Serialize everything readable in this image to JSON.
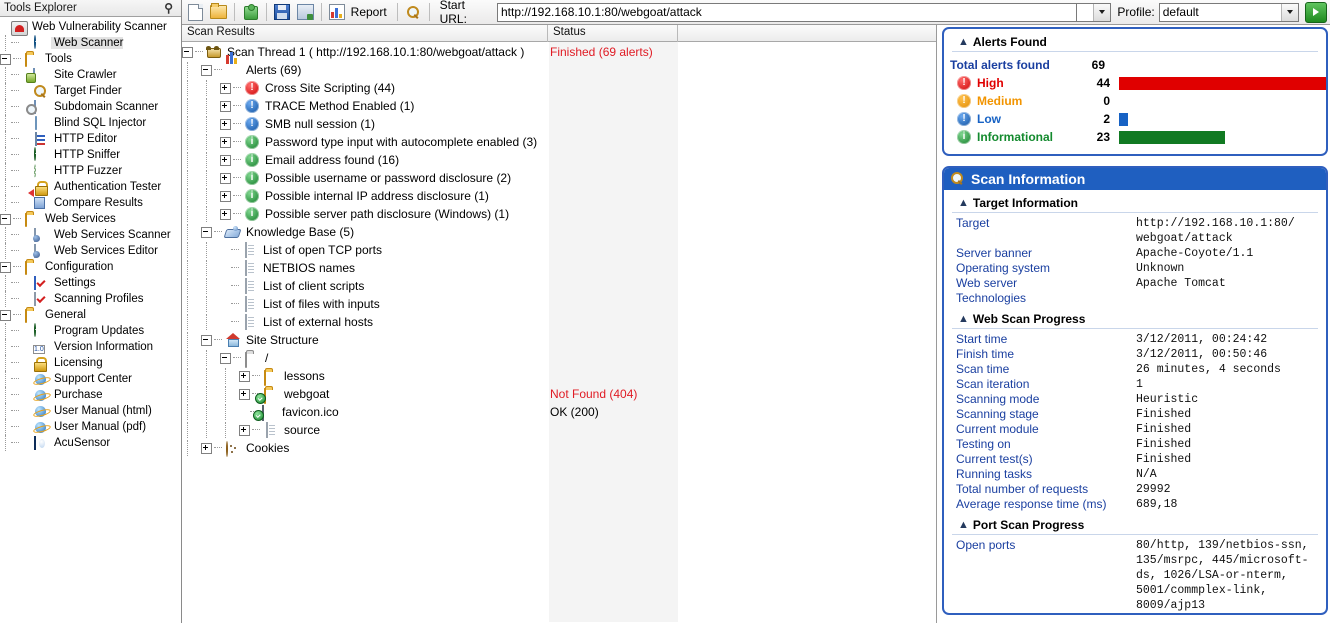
{
  "sidebar": {
    "title": "Tools Explorer",
    "pin_icon": "pin-icon",
    "items": [
      {
        "label": "Web Vulnerability Scanner",
        "icon": "app-logo-icon",
        "level": 0,
        "exp": "none"
      },
      {
        "label": "Web Scanner",
        "icon": "web-scanner-icon",
        "level": 1,
        "exp": "none",
        "selected": true
      },
      {
        "label": "Tools",
        "icon": "folder-icon",
        "level": 0,
        "exp": "minus"
      },
      {
        "label": "Site Crawler",
        "icon": "site-crawler-icon",
        "level": 1,
        "exp": "none"
      },
      {
        "label": "Target Finder",
        "icon": "target-finder-icon",
        "level": 1,
        "exp": "none"
      },
      {
        "label": "Subdomain Scanner",
        "icon": "subdomain-scanner-icon",
        "level": 1,
        "exp": "none"
      },
      {
        "label": "Blind SQL Injector",
        "icon": "blind-sql-injector-icon",
        "level": 1,
        "exp": "none"
      },
      {
        "label": "HTTP Editor",
        "icon": "http-editor-icon",
        "level": 1,
        "exp": "none"
      },
      {
        "label": "HTTP Sniffer",
        "icon": "http-sniffer-icon",
        "level": 1,
        "exp": "none"
      },
      {
        "label": "HTTP Fuzzer",
        "icon": "http-fuzzer-icon",
        "level": 1,
        "exp": "none"
      },
      {
        "label": "Authentication Tester",
        "icon": "authentication-tester-icon",
        "level": 1,
        "exp": "none"
      },
      {
        "label": "Compare Results",
        "icon": "compare-results-icon",
        "level": 1,
        "exp": "none"
      },
      {
        "label": "Web Services",
        "icon": "folder-icon",
        "level": 0,
        "exp": "minus"
      },
      {
        "label": "Web Services Scanner",
        "icon": "web-services-scanner-icon",
        "level": 1,
        "exp": "none"
      },
      {
        "label": "Web Services Editor",
        "icon": "web-services-editor-icon",
        "level": 1,
        "exp": "none"
      },
      {
        "label": "Configuration",
        "icon": "folder-icon",
        "level": 0,
        "exp": "minus"
      },
      {
        "label": "Settings",
        "icon": "settings-icon",
        "level": 1,
        "exp": "none"
      },
      {
        "label": "Scanning Profiles",
        "icon": "scanning-profiles-icon",
        "level": 1,
        "exp": "none"
      },
      {
        "label": "General",
        "icon": "folder-icon",
        "level": 0,
        "exp": "minus"
      },
      {
        "label": "Program Updates",
        "icon": "program-updates-icon",
        "level": 1,
        "exp": "none"
      },
      {
        "label": "Version Information",
        "icon": "version-information-icon",
        "level": 1,
        "exp": "none"
      },
      {
        "label": "Licensing",
        "icon": "licensing-icon",
        "level": 1,
        "exp": "none"
      },
      {
        "label": "Support Center",
        "icon": "support-center-icon",
        "level": 1,
        "exp": "none"
      },
      {
        "label": "Purchase",
        "icon": "purchase-icon",
        "level": 1,
        "exp": "none"
      },
      {
        "label": "User Manual (html)",
        "icon": "user-manual-html-icon",
        "level": 1,
        "exp": "none"
      },
      {
        "label": "User Manual (pdf)",
        "icon": "user-manual-pdf-icon",
        "level": 1,
        "exp": "none"
      },
      {
        "label": "AcuSensor",
        "icon": "acusensor-icon",
        "level": 1,
        "exp": "none"
      }
    ]
  },
  "toolbar": {
    "new_label": "new-scan-icon",
    "open_label": "open-icon",
    "addon_label": "addon-icon",
    "save_label": "save-icon",
    "saveas_label": "save-as-icon",
    "report_label": "Report",
    "search_label": "search-icon",
    "start_url_label": "Start URL:",
    "start_url_value": "http://192.168.10.1:80/webgoat/attack",
    "profile_label": "Profile:",
    "profile_value": "default",
    "go_label": "go-button"
  },
  "results": {
    "col_scan_results": "Scan Results",
    "col_status": "Status",
    "tree": [
      {
        "label": "Scan Thread 1 ( http://192.168.10.1:80/webgoat/attack )",
        "icon": "scan-thread-icon",
        "level": 0,
        "exp": "minus",
        "status": "Finished (69 alerts)",
        "status_color": "red"
      },
      {
        "label": "Alerts (69)",
        "icon": "alerts-chart-icon",
        "level": 1,
        "exp": "minus"
      },
      {
        "label": "Cross Site Scripting (44)",
        "icon": "severity-high-icon",
        "level": 2,
        "exp": "plus"
      },
      {
        "label": "TRACE Method Enabled (1)",
        "icon": "severity-low-icon",
        "level": 2,
        "exp": "plus"
      },
      {
        "label": "SMB null session (1)",
        "icon": "severity-low-icon",
        "level": 2,
        "exp": "plus"
      },
      {
        "label": "Password type input with autocomplete enabled (3)",
        "icon": "severity-info-icon",
        "level": 2,
        "exp": "plus"
      },
      {
        "label": "Email address found (16)",
        "icon": "severity-info-icon",
        "level": 2,
        "exp": "plus"
      },
      {
        "label": "Possible username or password disclosure (2)",
        "icon": "severity-info-icon",
        "level": 2,
        "exp": "plus"
      },
      {
        "label": "Possible internal IP address disclosure (1)",
        "icon": "severity-info-icon",
        "level": 2,
        "exp": "plus"
      },
      {
        "label": "Possible server path disclosure (Windows) (1)",
        "icon": "severity-info-icon",
        "level": 2,
        "exp": "plus"
      },
      {
        "label": "Knowledge Base (5)",
        "icon": "knowledge-base-icon",
        "level": 1,
        "exp": "minus"
      },
      {
        "label": "List of open TCP ports",
        "icon": "document-icon",
        "level": 2,
        "exp": "none"
      },
      {
        "label": "NETBIOS names",
        "icon": "document-icon",
        "level": 2,
        "exp": "none"
      },
      {
        "label": "List of client scripts",
        "icon": "document-icon",
        "level": 2,
        "exp": "none"
      },
      {
        "label": "List of files with inputs",
        "icon": "document-icon",
        "level": 2,
        "exp": "none"
      },
      {
        "label": "List of external hosts",
        "icon": "document-icon",
        "level": 2,
        "exp": "none"
      },
      {
        "label": "Site Structure",
        "icon": "site-structure-icon",
        "level": 1,
        "exp": "minus"
      },
      {
        "label": "/",
        "icon": "folder-open-icon",
        "level": 2,
        "exp": "minus"
      },
      {
        "label": "lessons",
        "icon": "folder-icon",
        "level": 3,
        "exp": "plus"
      },
      {
        "label": "webgoat",
        "icon": "folder-ok-icon",
        "level": 3,
        "exp": "plus",
        "status": "Not Found (404)",
        "status_color": "red"
      },
      {
        "label": "favicon.ico",
        "icon": "file-ok-icon",
        "level": 3,
        "exp": "none",
        "status": "OK (200)",
        "status_color": "blk"
      },
      {
        "label": "source",
        "icon": "document-icon",
        "level": 3,
        "exp": "plus"
      },
      {
        "label": "Cookies",
        "icon": "cookies-icon",
        "level": 1,
        "exp": "plus"
      }
    ]
  },
  "alerts_panel": {
    "title": "Alerts Found",
    "total_label": "Total alerts found",
    "total_value": "69",
    "rows": [
      {
        "name": "High",
        "value": "44",
        "bar_pct": 100,
        "color": "#e00000",
        "icon": "severity-high-icon"
      },
      {
        "name": "Medium",
        "value": "0",
        "bar_pct": 0,
        "color": "#f29400",
        "icon": "severity-medium-icon"
      },
      {
        "name": "Low",
        "value": "2",
        "bar_pct": 4.5,
        "color": "#1762c4",
        "icon": "severity-low-icon"
      },
      {
        "name": "Informational",
        "value": "23",
        "bar_pct": 51,
        "color": "#117a22",
        "icon": "severity-info-icon"
      }
    ]
  },
  "scan_info": {
    "title": "Scan Information",
    "title_icon": "scan-info-icon",
    "target_section": "Target Information",
    "target_rows": [
      {
        "k": "Target",
        "v": "http://192.168.10.1:80/\nwebgoat/attack"
      },
      {
        "k": "Server banner",
        "v": "Apache-Coyote/1.1"
      },
      {
        "k": "Operating system",
        "v": "Unknown"
      },
      {
        "k": "Web server",
        "v": "Apache Tomcat"
      },
      {
        "k": "Technologies",
        "v": ""
      }
    ],
    "web_scan_section": "Web Scan Progress",
    "web_scan_rows": [
      {
        "k": "Start time",
        "v": "3/12/2011, 00:24:42"
      },
      {
        "k": "Finish time",
        "v": "3/12/2011, 00:50:46"
      },
      {
        "k": "Scan time",
        "v": "26 minutes, 4 seconds"
      },
      {
        "k": "Scan iteration",
        "v": "1"
      },
      {
        "k": "Scanning mode",
        "v": "Heuristic"
      },
      {
        "k": "Scanning stage",
        "v": "Finished"
      },
      {
        "k": "Current module",
        "v": "Finished"
      },
      {
        "k": "Testing on",
        "v": "Finished"
      },
      {
        "k": "Current test(s)",
        "v": "Finished"
      },
      {
        "k": "Running tasks",
        "v": "N/A"
      },
      {
        "k": "Total number of requests",
        "v": "29992"
      },
      {
        "k": "Average response time (ms)",
        "v": "689,18"
      }
    ],
    "port_scan_section": "Port Scan Progress",
    "port_rows": [
      {
        "k": "Open ports",
        "v": "80/http, 139/netbios-ssn,\n135/msrpc, 445/microsoft-\nds, 1026/LSA-or-nterm,\n5001/commplex-link,\n8009/ajp13"
      }
    ]
  }
}
